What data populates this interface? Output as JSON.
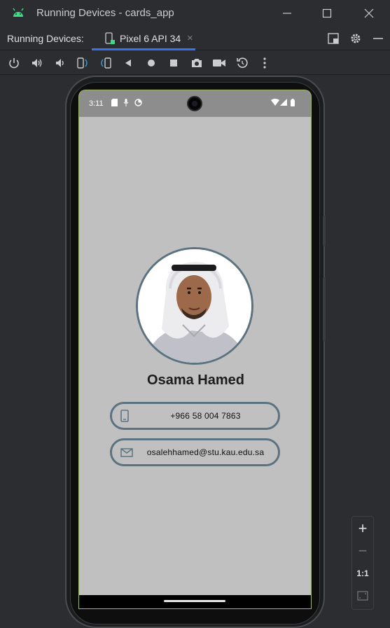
{
  "window": {
    "title": "Running Devices - cards_app",
    "controls": [
      "minimize",
      "maximize",
      "close"
    ]
  },
  "tabbar": {
    "label": "Running Devices:",
    "tab": {
      "label": "Pixel 6 API 34",
      "close": "×"
    }
  },
  "toolbar": {
    "tools": [
      "power",
      "volume-up",
      "volume-down",
      "rotate-left",
      "rotate-right",
      "back",
      "home",
      "overview",
      "screenshot",
      "screen-record",
      "reset",
      "more"
    ]
  },
  "device": {
    "status_time": "3:11",
    "profile": {
      "name": "Osama Hamed",
      "phone": "+966 58 004 7863",
      "email": "osalehhamed@stu.kau.edu.sa"
    },
    "colors": {
      "background": "#c0c0c0",
      "accent": "#5b7381",
      "status_bar": "#8d8d8d"
    }
  },
  "zoom": {
    "plus": "+",
    "minus": "−",
    "one_to_one": "1:1"
  },
  "colors": {
    "ide_background": "#2b2d30",
    "tab_underline": "#3574f0",
    "android_green": "#3ddc84"
  }
}
